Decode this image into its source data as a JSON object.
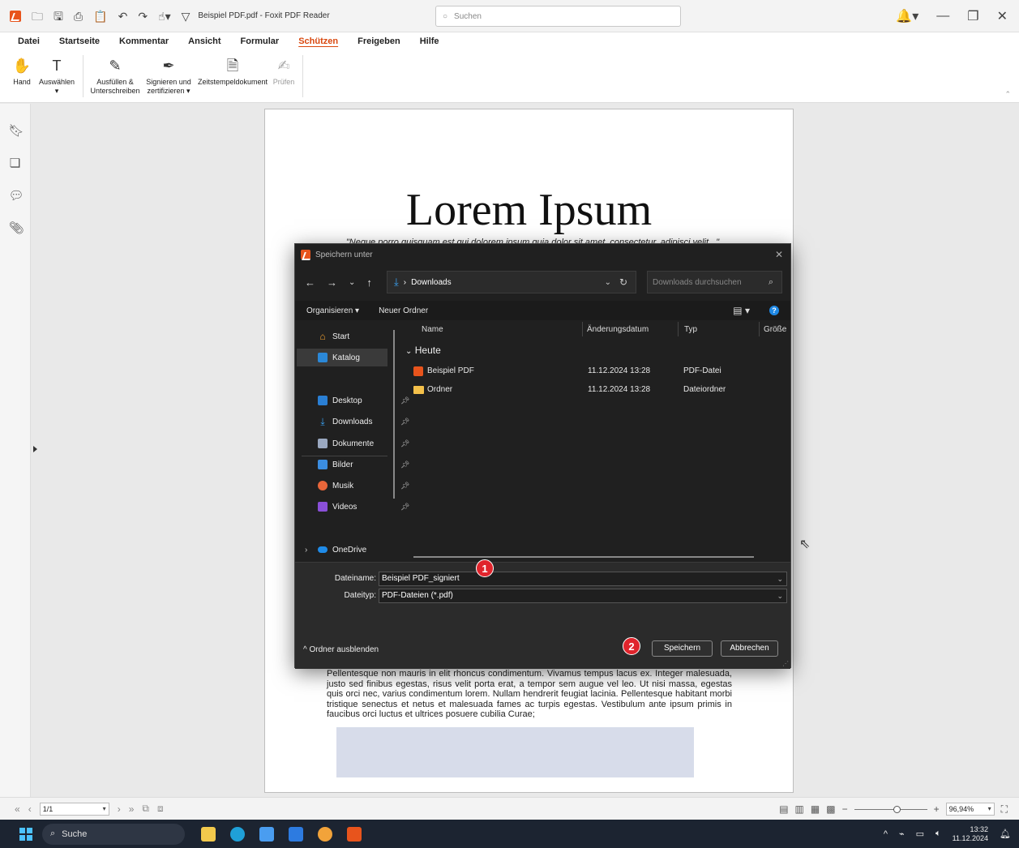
{
  "app": {
    "window_title": "Beispiel PDF.pdf - Foxit PDF Reader",
    "search_placeholder": "Suchen"
  },
  "menu": {
    "items": [
      "Datei",
      "Startseite",
      "Kommentar",
      "Ansicht",
      "Formular",
      "Schützen",
      "Freigeben",
      "Hilfe"
    ],
    "active": "Schützen"
  },
  "ribbon": {
    "hand": "Hand",
    "select": "Auswählen",
    "fill_sign_1": "Ausfüllen &",
    "fill_sign_2": "Unterschreiben",
    "sign_cert_1": "Signieren und",
    "sign_cert_2": "zertifizieren ▾",
    "timestamp": "Zeitstempeldokument",
    "validate": "Prüfen"
  },
  "document": {
    "title": "Lorem Ipsum",
    "quote": "\"Neque porro quisquam est qui dolorem ipsum quia dolor sit amet, consectetur, adipisci velit...\"",
    "paragraph": "Pellentesque non mauris in elit rhoncus condimentum. Vivamus tempus lacus ex. Integer malesuada, justo sed finibus egestas, risus velit porta erat, a tempor sem augue vel leo. Ut nisi massa, egestas quis orci nec, varius condimentum lorem. Nullam hendrerit feugiat lacinia. Pellentesque habitant morbi tristique senectus et netus et malesuada fames ac turpis egestas. Vestibulum ante ipsum primis in faucibus orci luctus et ultrices posuere cubilia Curae;"
  },
  "dialog": {
    "title": "Speichern unter",
    "address": "Downloads",
    "search_placeholder": "Downloads durchsuchen",
    "organize": "Organisieren ▾",
    "new_folder": "Neuer Ordner",
    "nav": {
      "start": "Start",
      "catalog": "Katalog",
      "desktop": "Desktop",
      "downloads": "Downloads",
      "documents": "Dokumente",
      "pictures": "Bilder",
      "music": "Musik",
      "videos": "Videos",
      "onedrive": "OneDrive"
    },
    "columns": {
      "name": "Name",
      "date": "Änderungsdatum",
      "type": "Typ",
      "size": "Größe"
    },
    "group": "Heute",
    "files": [
      {
        "name": "Beispiel PDF",
        "date": "11.12.2024 13:28",
        "type": "PDF-Datei"
      },
      {
        "name": "Ordner",
        "date": "11.12.2024 13:28",
        "type": "Dateiordner"
      }
    ],
    "filename_label": "Dateiname:",
    "filename_value": "Beispiel PDF_signiert",
    "filetype_label": "Dateityp:",
    "filetype_value": "PDF-Dateien (*.pdf)",
    "hide_folders": "^ Ordner ausblenden",
    "save": "Speichern",
    "cancel": "Abbrechen"
  },
  "badges": {
    "one": "1",
    "two": "2"
  },
  "statusbar": {
    "page": "1/1",
    "zoom": "96,94%"
  },
  "taskbar": {
    "search": "Suche",
    "time": "13:32",
    "date": "11.12.2024"
  },
  "colors": {
    "accent": "#d9480f",
    "foxit_orange": "#e8541c",
    "badge_red": "#e0242c",
    "dialog_bg": "#202020"
  }
}
